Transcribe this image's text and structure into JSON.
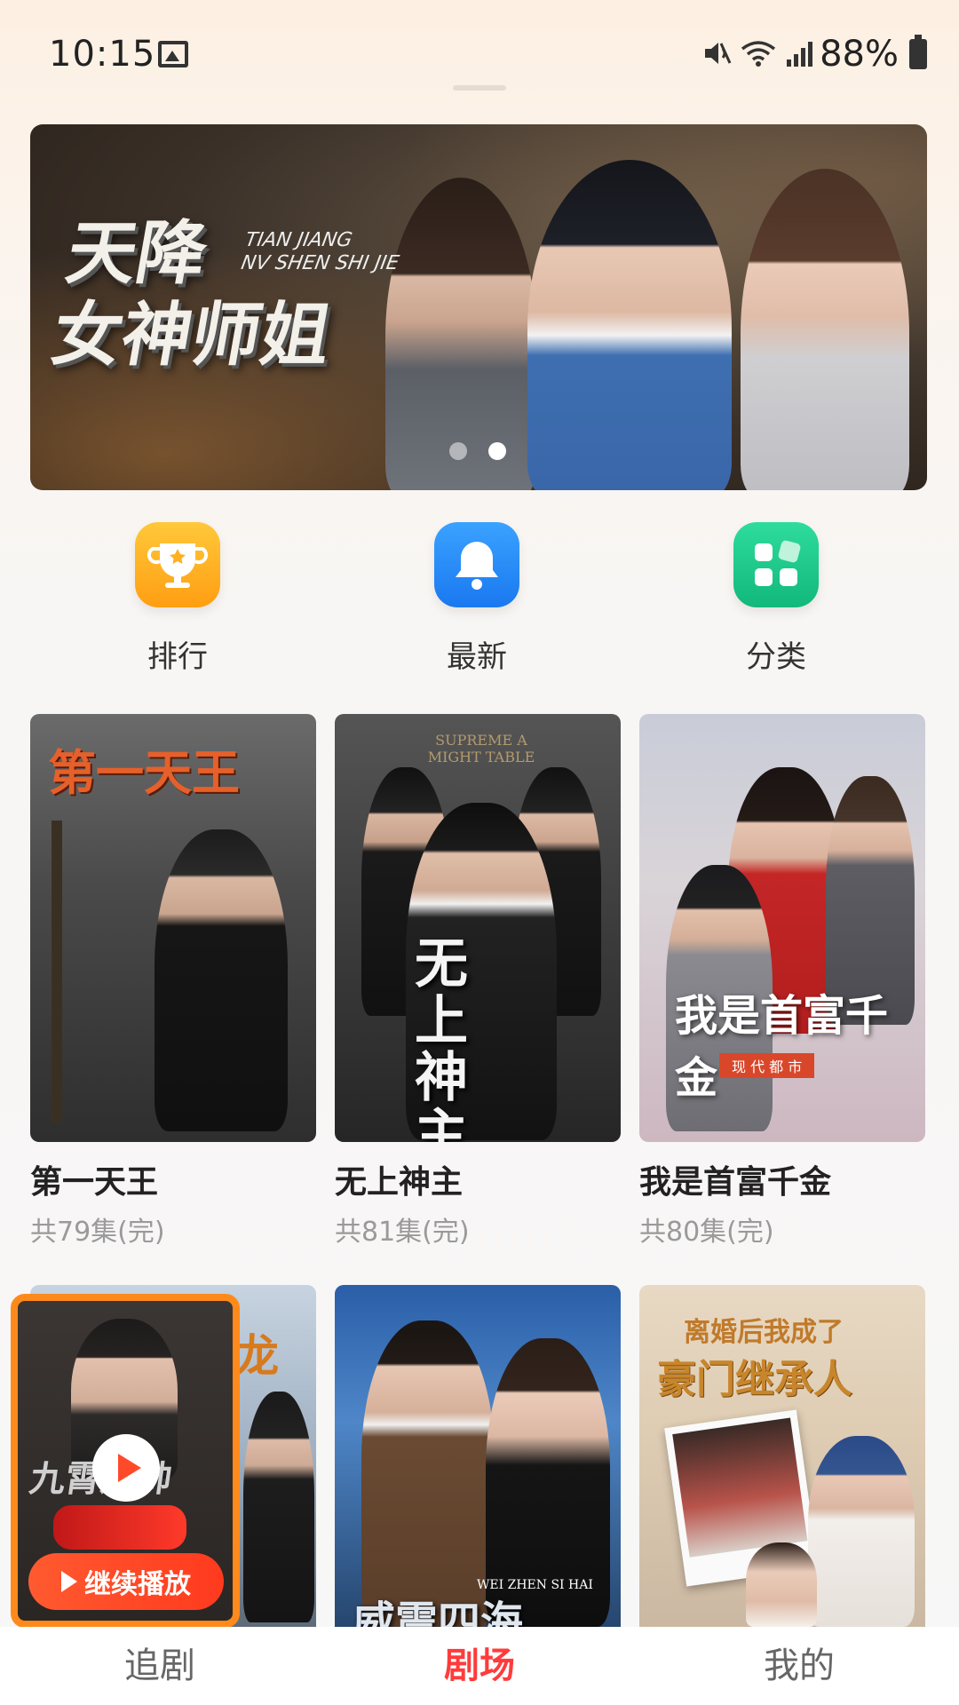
{
  "status_bar": {
    "time": "10:15",
    "battery": "88%"
  },
  "banner": {
    "title_line1": "天降",
    "title_line2": "女神师姐",
    "pinyin_line1": "TIAN JIANG",
    "pinyin_line2": "NV SHEN SHI JIE",
    "slides": 2,
    "active_slide": 2
  },
  "quick_menu": [
    {
      "label": "排行",
      "icon": "trophy-icon",
      "color": "#ffb020"
    },
    {
      "label": "最新",
      "icon": "bell-icon",
      "color": "#2a8cf5"
    },
    {
      "label": "分类",
      "icon": "grid-icon",
      "color": "#19c58c"
    }
  ],
  "dramas": [
    {
      "title": "第一天王",
      "episodes": "共79集(完)",
      "poster_text": "第一天王"
    },
    {
      "title": "无上神主",
      "episodes": "共81集(完)",
      "poster_text": "无上神主",
      "poster_caption": "SUPREME A MIGHT TABLE"
    },
    {
      "title": "我是首富千金",
      "episodes": "共80集(完)",
      "poster_text": "我是首富千金",
      "poster_caption": "现 代 都 市"
    }
  ],
  "row2_posters": [
    {
      "poster_text": "九霄龙帅"
    },
    {
      "poster_text": "威震四海",
      "poster_caption": "WEI ZHEN SI HAI"
    },
    {
      "poster_text_line1": "离婚后我成了",
      "poster_text_line2": "豪门继承人"
    }
  ],
  "continue_widget": {
    "label": "继续播放"
  },
  "bottom_nav": [
    {
      "label": "追剧",
      "active": false
    },
    {
      "label": "剧场",
      "active": true
    },
    {
      "label": "我的",
      "active": false
    }
  ]
}
